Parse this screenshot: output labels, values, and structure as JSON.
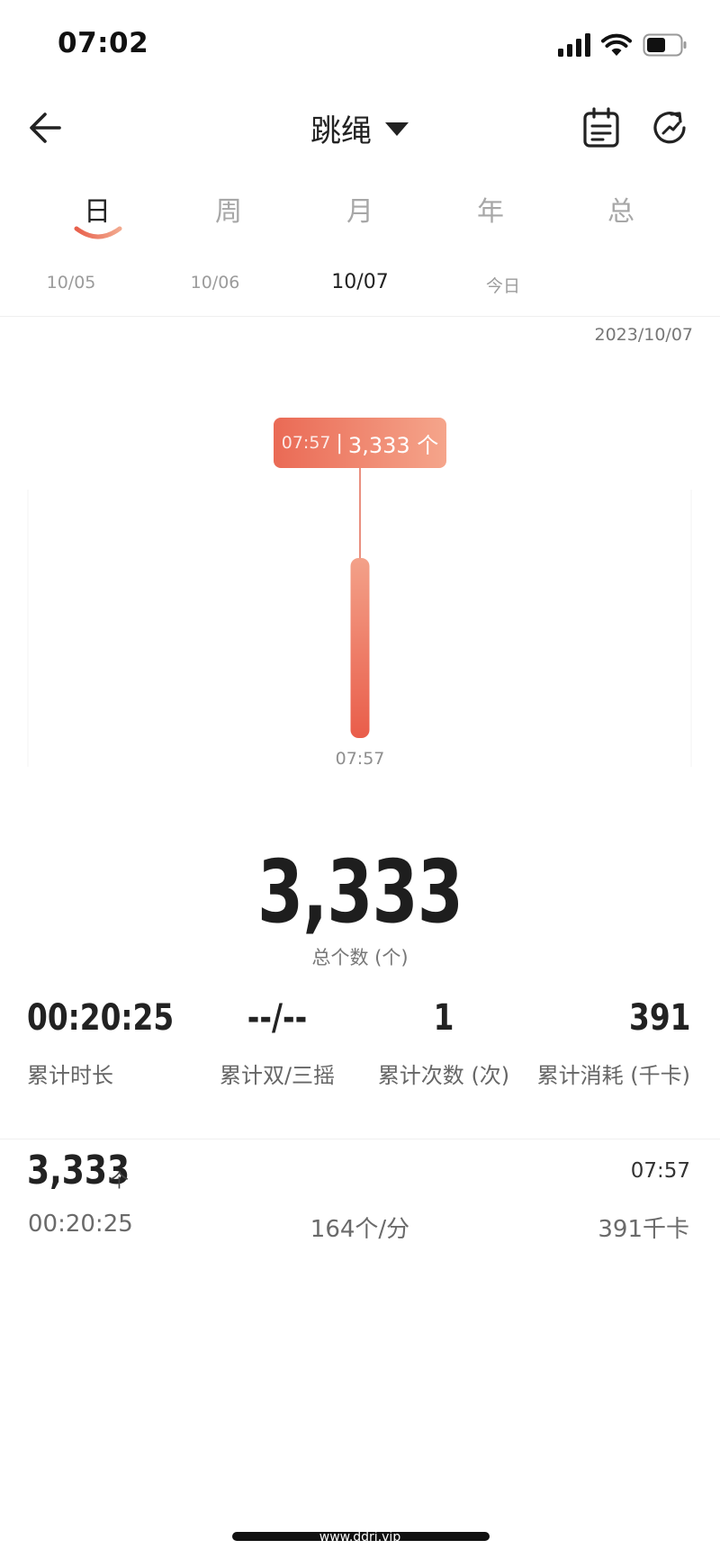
{
  "status_bar": {
    "time": "07:02",
    "icons": [
      "signal-icon",
      "wifi-icon",
      "battery-icon"
    ]
  },
  "header": {
    "title": "跳绳",
    "icons": [
      "back-arrow-icon",
      "dropdown-triangle-icon",
      "calendar-icon",
      "refresh-icon"
    ]
  },
  "tabs": [
    {
      "label": "日",
      "active": true
    },
    {
      "label": "周",
      "active": false
    },
    {
      "label": "月",
      "active": false
    },
    {
      "label": "年",
      "active": false
    },
    {
      "label": "总",
      "active": false
    }
  ],
  "dates": [
    {
      "label": "10/05",
      "active": false
    },
    {
      "label": "10/06",
      "active": false
    },
    {
      "label": "10/07",
      "active": true
    },
    {
      "label": "今日",
      "active": false
    }
  ],
  "selected_date": "2023/10/07",
  "chart_data": {
    "type": "bar",
    "categories": [
      "07:57"
    ],
    "values": [
      3333
    ],
    "tooltip": {
      "time": "07:57",
      "separator": "|",
      "count": "3,333 个"
    },
    "colors": {
      "bar_top": "#f3a189",
      "bar_bottom": "#e95d4a",
      "guide_line": "#e26a55"
    }
  },
  "summary": {
    "total": "3,333",
    "total_label": "总个数 (个)"
  },
  "stats": [
    {
      "value": "00:20:25",
      "label": "累计时长"
    },
    {
      "value": "--/--",
      "label": "累计双/三摇"
    },
    {
      "value": "1",
      "label": "累计次数 (次)"
    },
    {
      "value": "391",
      "label": "累计消耗 (千卡)"
    }
  ],
  "record": {
    "count": "3,333",
    "unit": "个",
    "time": "07:57",
    "duration": "00:20:25",
    "pace": "164个/分",
    "calories": "391千卡"
  },
  "watermark": "www.ddrj.vip"
}
